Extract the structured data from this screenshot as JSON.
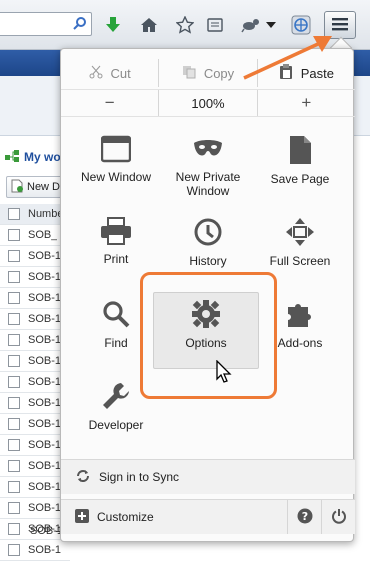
{
  "toolbar": {
    "icons": [
      "search-icon",
      "download-icon",
      "home-icon",
      "bookmark-star-icon",
      "bookmarks-list-icon",
      "extension-icon",
      "dropdown-icon",
      "web-icon",
      "hamburger-menu-icon"
    ]
  },
  "background_page": {
    "my_work": "My wo",
    "new_button": "New D",
    "column_header": "Number",
    "rows": [
      "SOB_",
      "SOB-1",
      "SOB-1",
      "SOB-1",
      "SOB-1",
      "SOB-1",
      "SOB-1",
      "SOB-1",
      "SOB-1",
      "SOB-1",
      "SOB-1",
      "SOB-1",
      "SOB-1",
      "SOB-1",
      "SOB-1",
      "SOB-1"
    ],
    "bottom_text": "SOB-1 ... ... ..."
  },
  "menu": {
    "edit": {
      "cut": "Cut",
      "copy": "Copy",
      "paste": "Paste"
    },
    "zoom": {
      "minus": "−",
      "level": "100%",
      "plus": "+"
    },
    "items": [
      {
        "label": "New Window",
        "icon": "window-icon"
      },
      {
        "label": "New Private Window",
        "icon": "mask-icon"
      },
      {
        "label": "Save Page",
        "icon": "page-icon"
      },
      {
        "label": "Print",
        "icon": "printer-icon"
      },
      {
        "label": "History",
        "icon": "clock-icon"
      },
      {
        "label": "Full Screen",
        "icon": "fullscreen-icon"
      },
      {
        "label": "Find",
        "icon": "magnifier-icon"
      },
      {
        "label": "Options",
        "icon": "gear-icon"
      },
      {
        "label": "Add-ons",
        "icon": "puzzle-icon"
      },
      {
        "label": "Developer",
        "icon": "wrench-icon"
      }
    ],
    "sign_in": "Sign in to Sync",
    "customize": "Customize"
  },
  "colors": {
    "annotation": "#ee7a36",
    "page_header": "#1d4689"
  }
}
